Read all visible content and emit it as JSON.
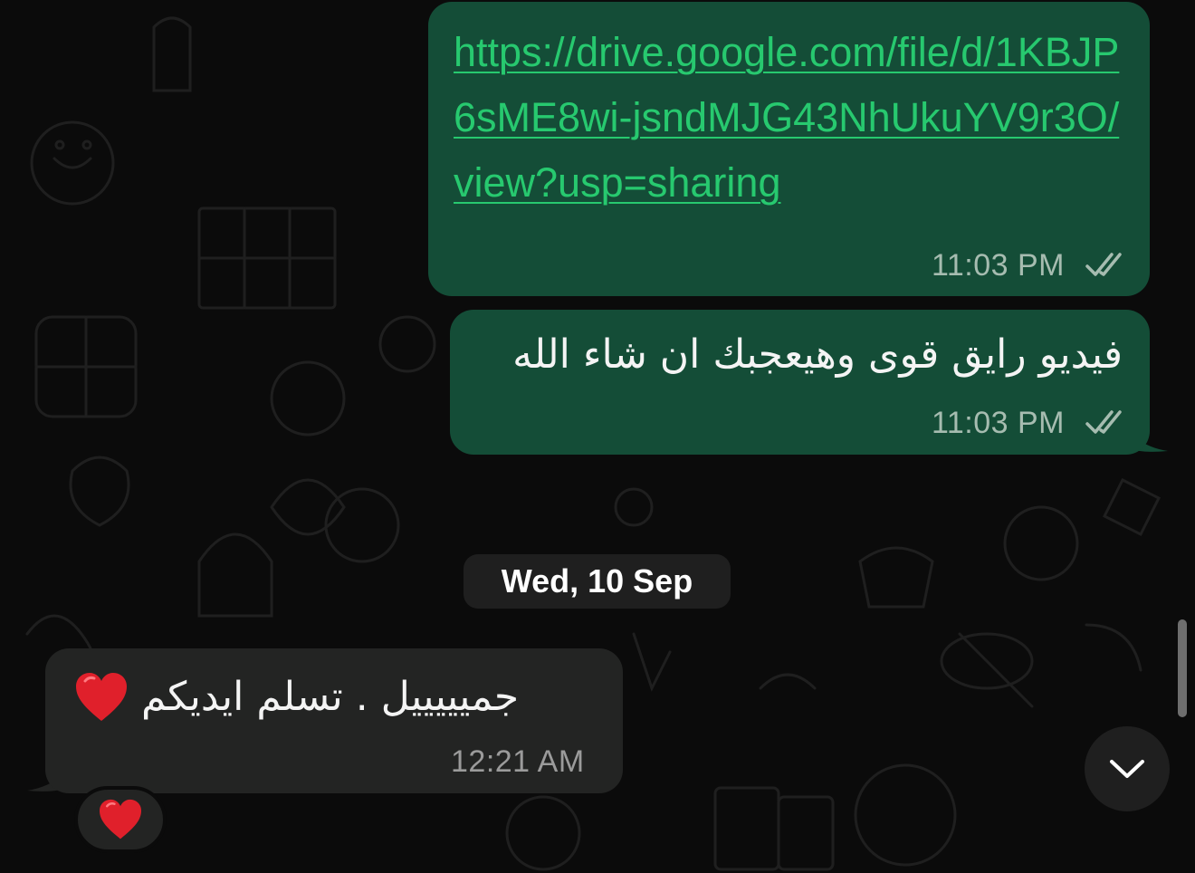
{
  "messages": {
    "link": {
      "text": "https://drive.google.com/file/d/1KBJP6sME8wi-jsndMJG43NhUkuYV9r3O/view?usp=sharing",
      "time": "11:03 PM"
    },
    "arabic_out": {
      "text": "فيديو رايق قوى وهيعجبك ان شاء الله",
      "time": "11:03 PM"
    },
    "incoming": {
      "text": "جميييييل . تسلم ايديكم",
      "emoji": "heart-emoji",
      "time": "12:21 AM",
      "reaction": "heart-emoji"
    }
  },
  "date_separator": "Wed, 10 Sep",
  "icons": {
    "read_receipt": "double-check-icon",
    "scroll_down": "chevron-down-icon"
  },
  "colors": {
    "outgoing_bubble": "#144d37",
    "incoming_bubble": "#232423",
    "link": "#27c96f",
    "background": "#0b0b0b"
  }
}
